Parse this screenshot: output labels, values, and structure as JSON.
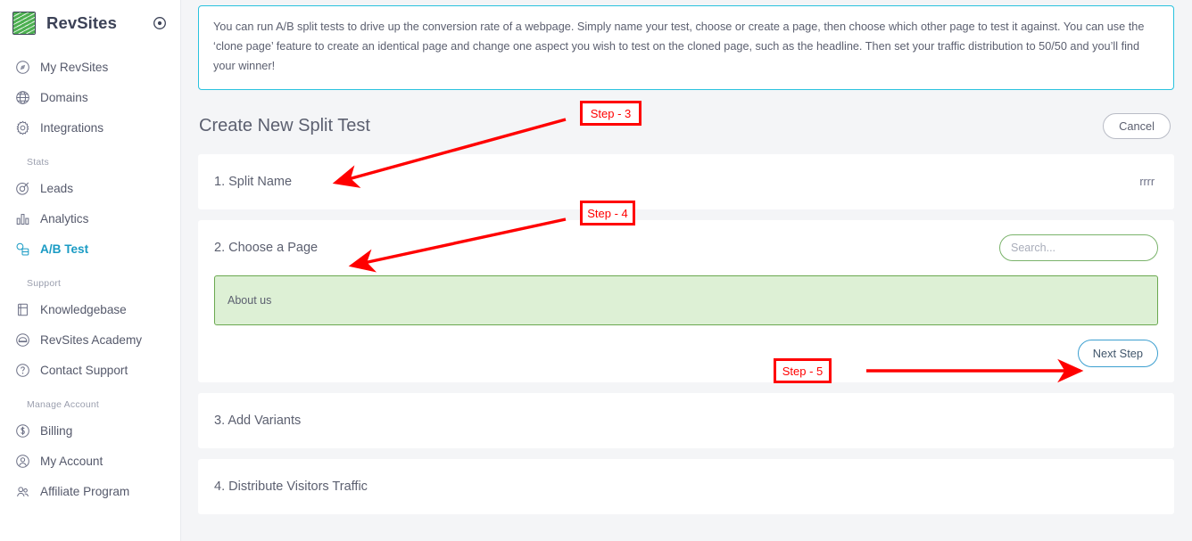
{
  "sidebar": {
    "brand": {
      "name": "RevSites",
      "logo_icon": "revsites-leaf-logo",
      "toggle_icon": "circle-target-icon"
    },
    "items": [
      {
        "label": "My RevSites",
        "icon": "compass-icon",
        "name": "my-revsites",
        "active": false
      },
      {
        "label": "Domains",
        "icon": "globe-icon",
        "name": "domains",
        "active": false
      },
      {
        "label": "Integrations",
        "icon": "gear-icon",
        "name": "integrations",
        "active": false
      }
    ],
    "groups": [
      {
        "label": "Stats",
        "items": [
          {
            "label": "Leads",
            "icon": "target-icon",
            "name": "leads",
            "active": false
          },
          {
            "label": "Analytics",
            "icon": "bar-chart-icon",
            "name": "analytics",
            "active": false
          },
          {
            "label": "A/B Test",
            "icon": "ab-test-icon",
            "name": "ab-test",
            "active": true
          }
        ]
      },
      {
        "label": "Support",
        "items": [
          {
            "label": "Knowledgebase",
            "icon": "book-icon",
            "name": "knowledgebase",
            "active": false
          },
          {
            "label": "RevSites Academy",
            "icon": "graduation-cap-icon",
            "name": "revsites-academy",
            "active": false
          },
          {
            "label": "Contact Support",
            "icon": "question-circle-icon",
            "name": "contact-support",
            "active": false
          }
        ]
      },
      {
        "label": "Manage Account",
        "items": [
          {
            "label": "Billing",
            "icon": "dollar-circle-icon",
            "name": "billing",
            "active": false
          },
          {
            "label": "My Account",
            "icon": "user-circle-icon",
            "name": "my-account",
            "active": false
          },
          {
            "label": "Affiliate Program",
            "icon": "users-icon",
            "name": "affiliate-program",
            "active": false
          }
        ]
      }
    ]
  },
  "banner": {
    "text": "You can run A/B split tests to drive up the conversion rate of a webpage. Simply name your test, choose or create a page, then choose which other page to test it against. You can use the ‘clone page’ feature to create an identical page and change one aspect you wish to test on the cloned page, such as the headline. Then set your traffic distribution to 50/50 and you’ll find your winner!",
    "border_color": "#29c2de"
  },
  "header": {
    "title": "Create New Split Test",
    "cancel_label": "Cancel"
  },
  "sections": {
    "split_name": {
      "title": "1. Split Name",
      "value": "rrrr"
    },
    "choose_page": {
      "title": "2. Choose a Page",
      "search_placeholder": "Search...",
      "search_value": "",
      "search_icon": "search-icon",
      "options": [
        {
          "label": "About us",
          "selected": true
        }
      ],
      "next_label": "Next Step"
    },
    "add_variants": {
      "title": "3. Add Variants"
    },
    "distribute_traffic": {
      "title": "4. Distribute Visitors Traffic"
    }
  },
  "annotations": [
    {
      "label": "Step - 3",
      "name": "annotation-step-3"
    },
    {
      "label": "Step - 4",
      "name": "annotation-step-4"
    },
    {
      "label": "Step - 5",
      "name": "annotation-step-5"
    }
  ],
  "colors": {
    "accent_teal": "#1a9bc4",
    "banner_border": "#29c2de",
    "selected_green_bg": "#ddf0d5",
    "selected_green_border": "#6aa84f",
    "annotation_red": "#ff0000"
  }
}
